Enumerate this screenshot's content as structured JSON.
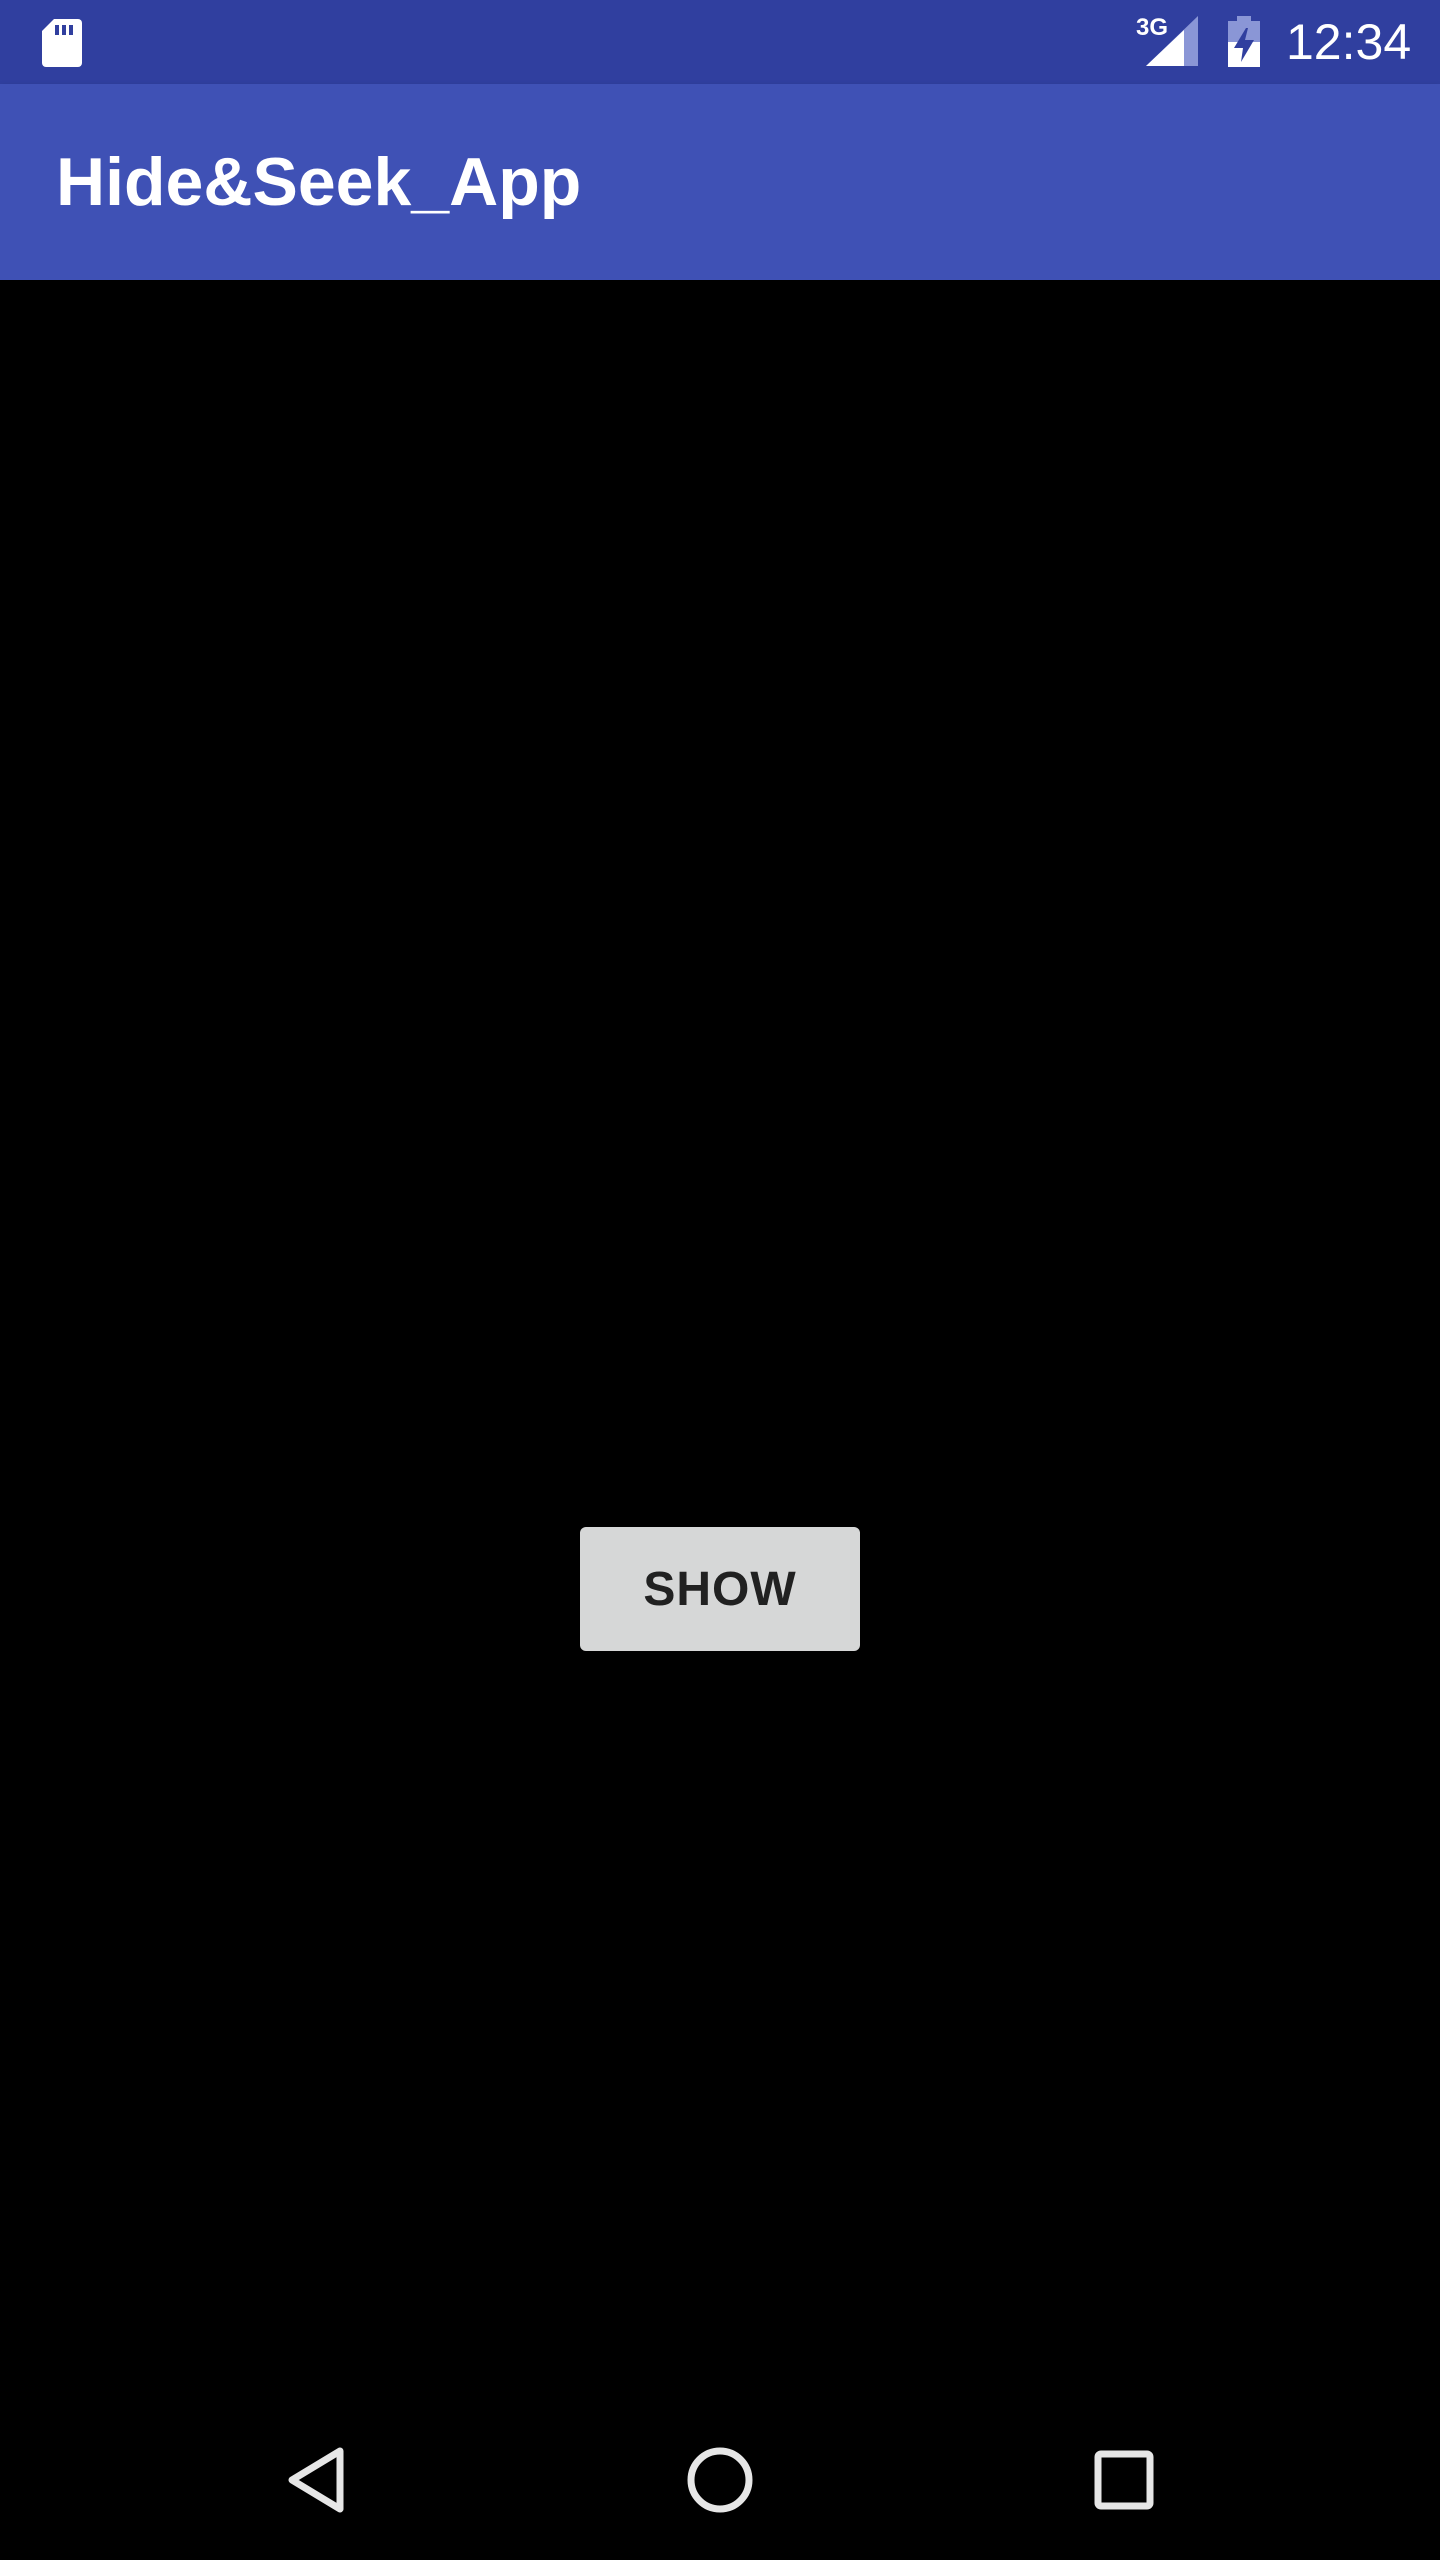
{
  "status_bar": {
    "network_type": "3G",
    "time": "12:34",
    "background_color": "#303F9F",
    "icons": [
      "sd-card-icon",
      "cell-signal-icon",
      "battery-charging-icon"
    ]
  },
  "toolbar": {
    "title": "Hide&Seek_App",
    "background_color": "#3F51B5"
  },
  "main": {
    "background_color": "#000000",
    "show_button_label": "SHOW",
    "button_color": "#D6D7D7"
  },
  "nav_bar": {
    "icons": [
      "back-icon",
      "home-icon",
      "recents-icon"
    ]
  }
}
